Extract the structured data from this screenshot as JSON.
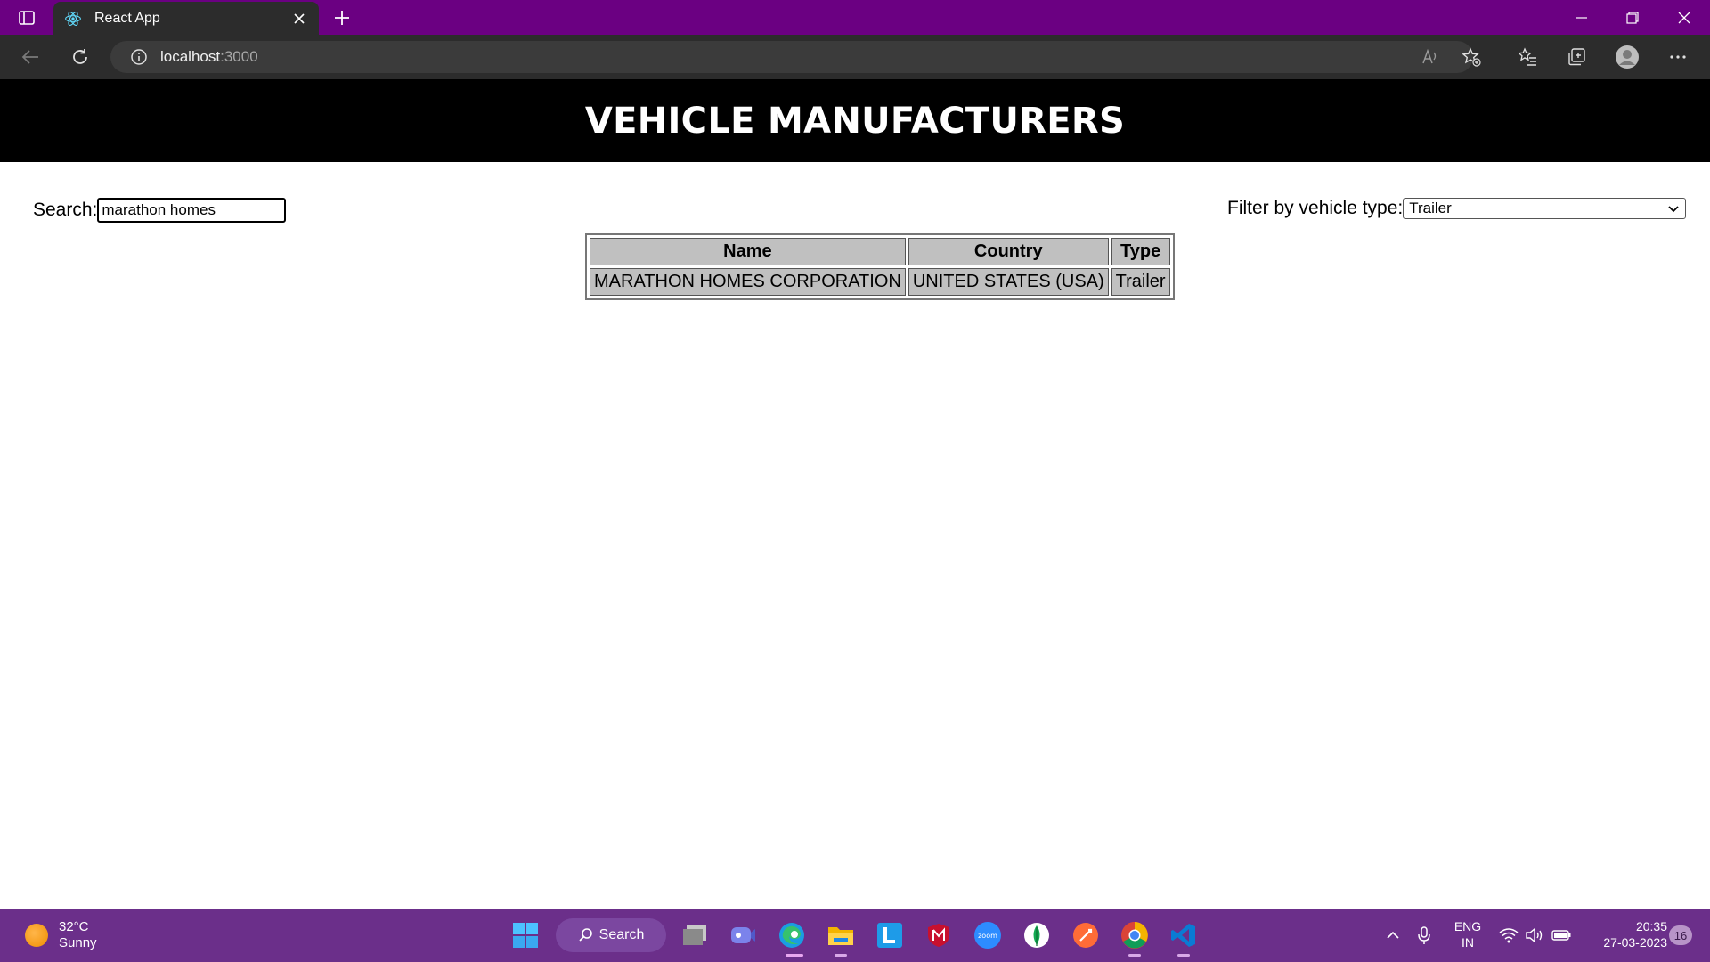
{
  "browser": {
    "tab_title": "React App",
    "url_host": "localhost",
    "url_port": ":3000"
  },
  "page": {
    "heading": "VEHICLE MANUFACTURERS",
    "search_label": "Search:",
    "search_value": "marathon homes",
    "filter_label": "Filter by vehicle type:",
    "filter_value": "Trailer",
    "table": {
      "headers": [
        "Name",
        "Country",
        "Type"
      ],
      "rows": [
        [
          "MARATHON HOMES CORPORATION",
          "UNITED STATES (USA)",
          "Trailer"
        ]
      ]
    }
  },
  "taskbar": {
    "weather_temp": "32°C",
    "weather_cond": "Sunny",
    "search_label": "Search",
    "lang_top": "ENG",
    "lang_bottom": "IN",
    "time": "20:35",
    "date": "27-03-2023",
    "notification_count": "16"
  },
  "colors": {
    "titlebar": "#6b0082",
    "toolbar": "#2c2c2c",
    "banner": "#000000",
    "table_cell": "#c0c0c0",
    "taskbar": "#6b2f8a"
  }
}
